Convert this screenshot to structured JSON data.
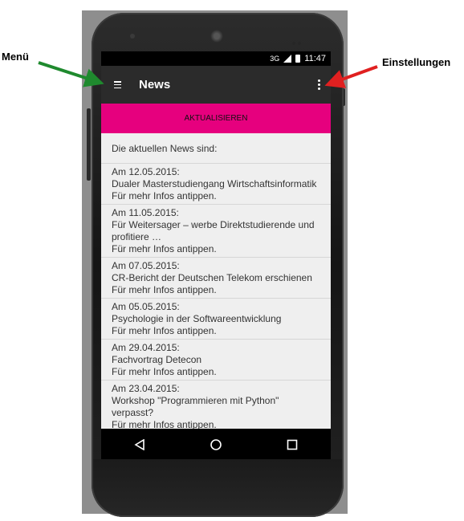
{
  "annotations": {
    "menu": "Menü",
    "settings": "Einstellungen"
  },
  "status_bar": {
    "network": "3G",
    "time": "11:47"
  },
  "app_bar": {
    "title": "News"
  },
  "refresh_button": "AKTUALISIEREN",
  "list_header": "Die aktuellen News sind:",
  "news": [
    {
      "date": "Am 12.05.2015:",
      "text": "Dualer Masterstudiengang Wirtschaftsinformatik",
      "more": "Für mehr Infos antippen."
    },
    {
      "date": "Am 11.05.2015:",
      "text": "Für Weitersager – werbe Direktstudierende und profitiere …",
      "more": "Für mehr Infos antippen."
    },
    {
      "date": "Am 07.05.2015:",
      "text": "CR-Bericht der Deutschen Telekom erschienen",
      "more": "Für mehr Infos antippen."
    },
    {
      "date": "Am 05.05.2015:",
      "text": "Psychologie in der Softwareentwicklung",
      "more": "Für mehr Infos antippen."
    },
    {
      "date": "Am 29.04.2015:",
      "text": "Fachvortrag Detecon",
      "more": "Für mehr Infos antippen."
    },
    {
      "date": "Am 23.04.2015:",
      "text": "Workshop \"Programmieren mit Python\" verpasst?",
      "more": "Für mehr Infos antippen."
    }
  ],
  "colors": {
    "accent": "#e6007e",
    "menu_arrow": "#1f8a2e",
    "settings_arrow": "#e02020"
  }
}
